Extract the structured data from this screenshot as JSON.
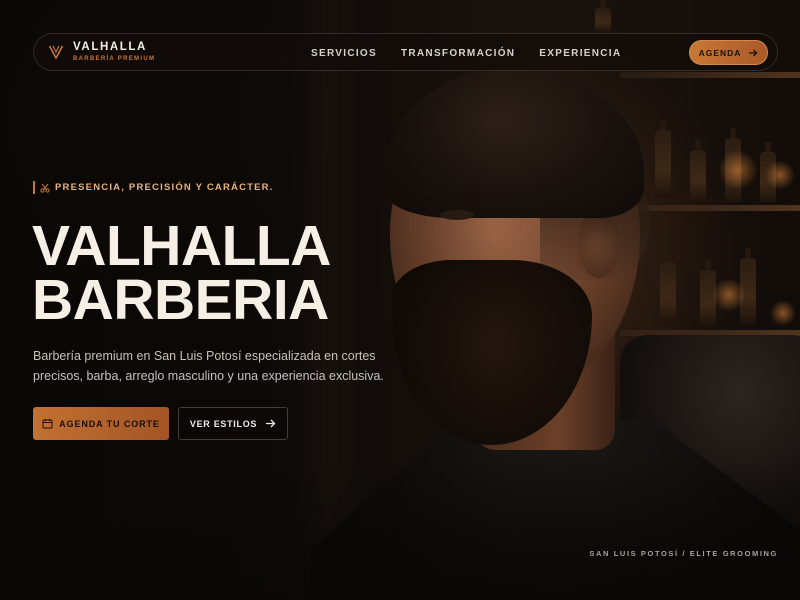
{
  "nav": {
    "brand_name": "VALHALLA",
    "brand_subtitle": "BARBERÍA PREMIUM",
    "logo_icon": "v-monogram-icon",
    "links": [
      {
        "label": "SERVICIOS"
      },
      {
        "label": "TRANSFORMACIÓN"
      },
      {
        "label": "EXPERIENCIA"
      }
    ],
    "cta_label": "AGENDA",
    "cta_icon": "arrow-right-icon"
  },
  "hero": {
    "eyebrow": "PRESENCIA, PRECISIÓN Y CARÁCTER.",
    "eyebrow_icon": "scissors-icon",
    "title_line1": "VALHALLA",
    "title_line2": "BARBERIA",
    "description": "Barbería premium en San Luis Potosí especializada en cortes precisos, barba, arreglo masculino y una experiencia exclusiva.",
    "primary_button": {
      "label": "AGENDA TU CORTE",
      "icon": "calendar-icon"
    },
    "secondary_button": {
      "label": "VER ESTILOS",
      "icon": "arrow-right-icon"
    }
  },
  "footer_tag": "SAN LUIS POTOSÍ / ELITE GROOMING",
  "colors": {
    "accent": "#c7773a",
    "accent_light": "#e6b47e",
    "background": "#0d0907",
    "text": "#f5efe6"
  }
}
